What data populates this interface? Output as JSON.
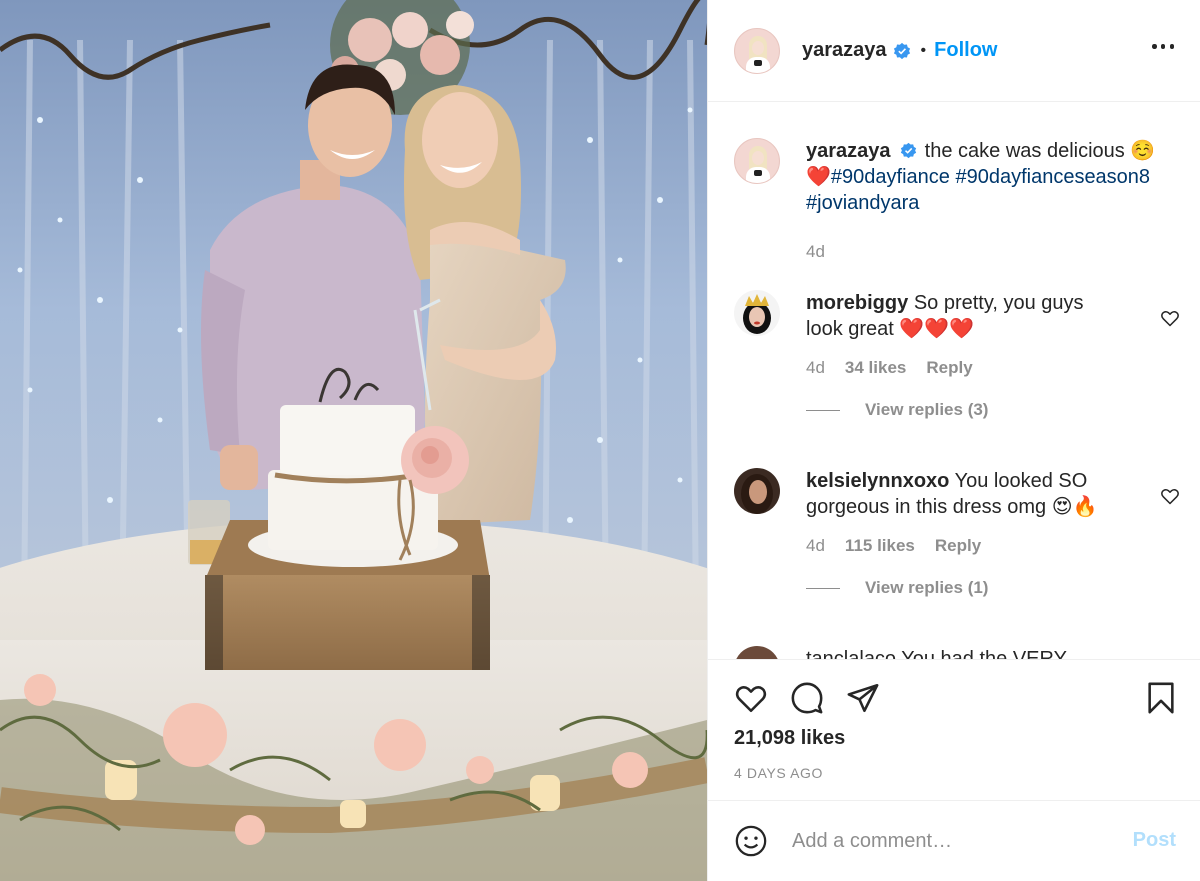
{
  "author": {
    "username": "yarazaya",
    "follow_label": "Follow",
    "separator": "•"
  },
  "caption": {
    "username": "yarazaya",
    "text": "the cake was delicious",
    "emoji_smile": "☺️",
    "emoji_heart": "❤️",
    "hashtags": [
      "#90dayfiance",
      "#90dayfianceseason8",
      "#joviandyara"
    ],
    "time": "4d"
  },
  "comments": [
    {
      "username": "morebiggy",
      "text_line1": "So pretty, you guys",
      "text_line2": "look great",
      "emoji": "❤️❤️❤️",
      "time": "4d",
      "likes": "34 likes",
      "reply_label": "Reply",
      "view_replies": "View replies (3)"
    },
    {
      "username": "kelsielynnxoxo",
      "text_line1": "You looked SO",
      "text_line2": "gorgeous in this dress omg",
      "emoji": "😍🔥",
      "time": "4d",
      "likes": "115 likes",
      "reply_label": "Reply",
      "view_replies": "View replies (1)"
    },
    {
      "partial": "tanclalaco  You had the VERY"
    }
  ],
  "stats": {
    "likes": "21,098 likes",
    "posted": "4 DAYS AGO"
  },
  "comment_box": {
    "placeholder": "Add a comment…",
    "post_label": "Post"
  },
  "colors": {
    "accent": "#0095f6",
    "hashtag": "#00376b",
    "muted": "#8e8e8e",
    "post_disabled": "#b2dffc"
  }
}
